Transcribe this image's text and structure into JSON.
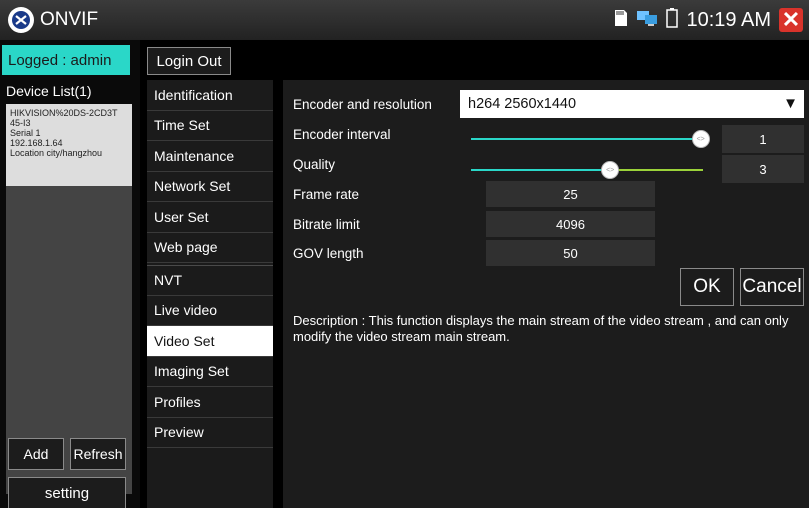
{
  "app": {
    "title": "ONVIF",
    "app_icon": "onvif-logo-icon",
    "close_icon": "close-icon"
  },
  "status_bar": {
    "time": "10:19 AM",
    "icons": [
      "sd-card-icon",
      "network-icon",
      "battery-icon"
    ]
  },
  "sidebar": {
    "logged_in": "Logged : admin",
    "device_list_title": "Device List(1)",
    "device": {
      "line1": "HIKVISION%20DS-2CD3T",
      "line2": "45-I3",
      "line3": "Serial  1",
      "line4": "192.168.1.64",
      "line5": "Location  city/hangzhou"
    },
    "add_label": "Add",
    "refresh_label": "Refresh",
    "setting_label": "setting"
  },
  "menu": {
    "logout_label": "Login Out",
    "items": [
      {
        "label": "Identification"
      },
      {
        "label": "Time Set"
      },
      {
        "label": "Maintenance"
      },
      {
        "label": "Network Set"
      },
      {
        "label": "User Set"
      },
      {
        "label": "Web page"
      },
      {
        "label": "NVT"
      },
      {
        "label": "Live video"
      },
      {
        "label": "Video Set"
      },
      {
        "label": "Imaging Set"
      },
      {
        "label": "Profiles"
      },
      {
        "label": "Preview"
      }
    ],
    "active": "Video Set"
  },
  "video_set": {
    "encoder_label": "Encoder and resolution",
    "encoder_value": "h264 2560x1440",
    "encoder_interval_label": "Encoder interval",
    "encoder_interval_value": "1",
    "encoder_interval_level": 0.99,
    "quality_label": "Quality",
    "quality_value": "3",
    "quality_level": 0.6,
    "frame_rate_label": "Frame rate",
    "frame_rate_value": "25",
    "bitrate_label": "Bitrate limit",
    "bitrate_value": "4096",
    "gov_label": "GOV length",
    "gov_value": "50",
    "ok_label": "OK",
    "cancel_label": "Cancel",
    "description": "Description : This function displays the main stream of the video stream , and can only modify the video stream main stream."
  },
  "colors": {
    "accent": "#2ad7c8",
    "slider_rest": "#9bd23a",
    "close": "#d9332b"
  }
}
